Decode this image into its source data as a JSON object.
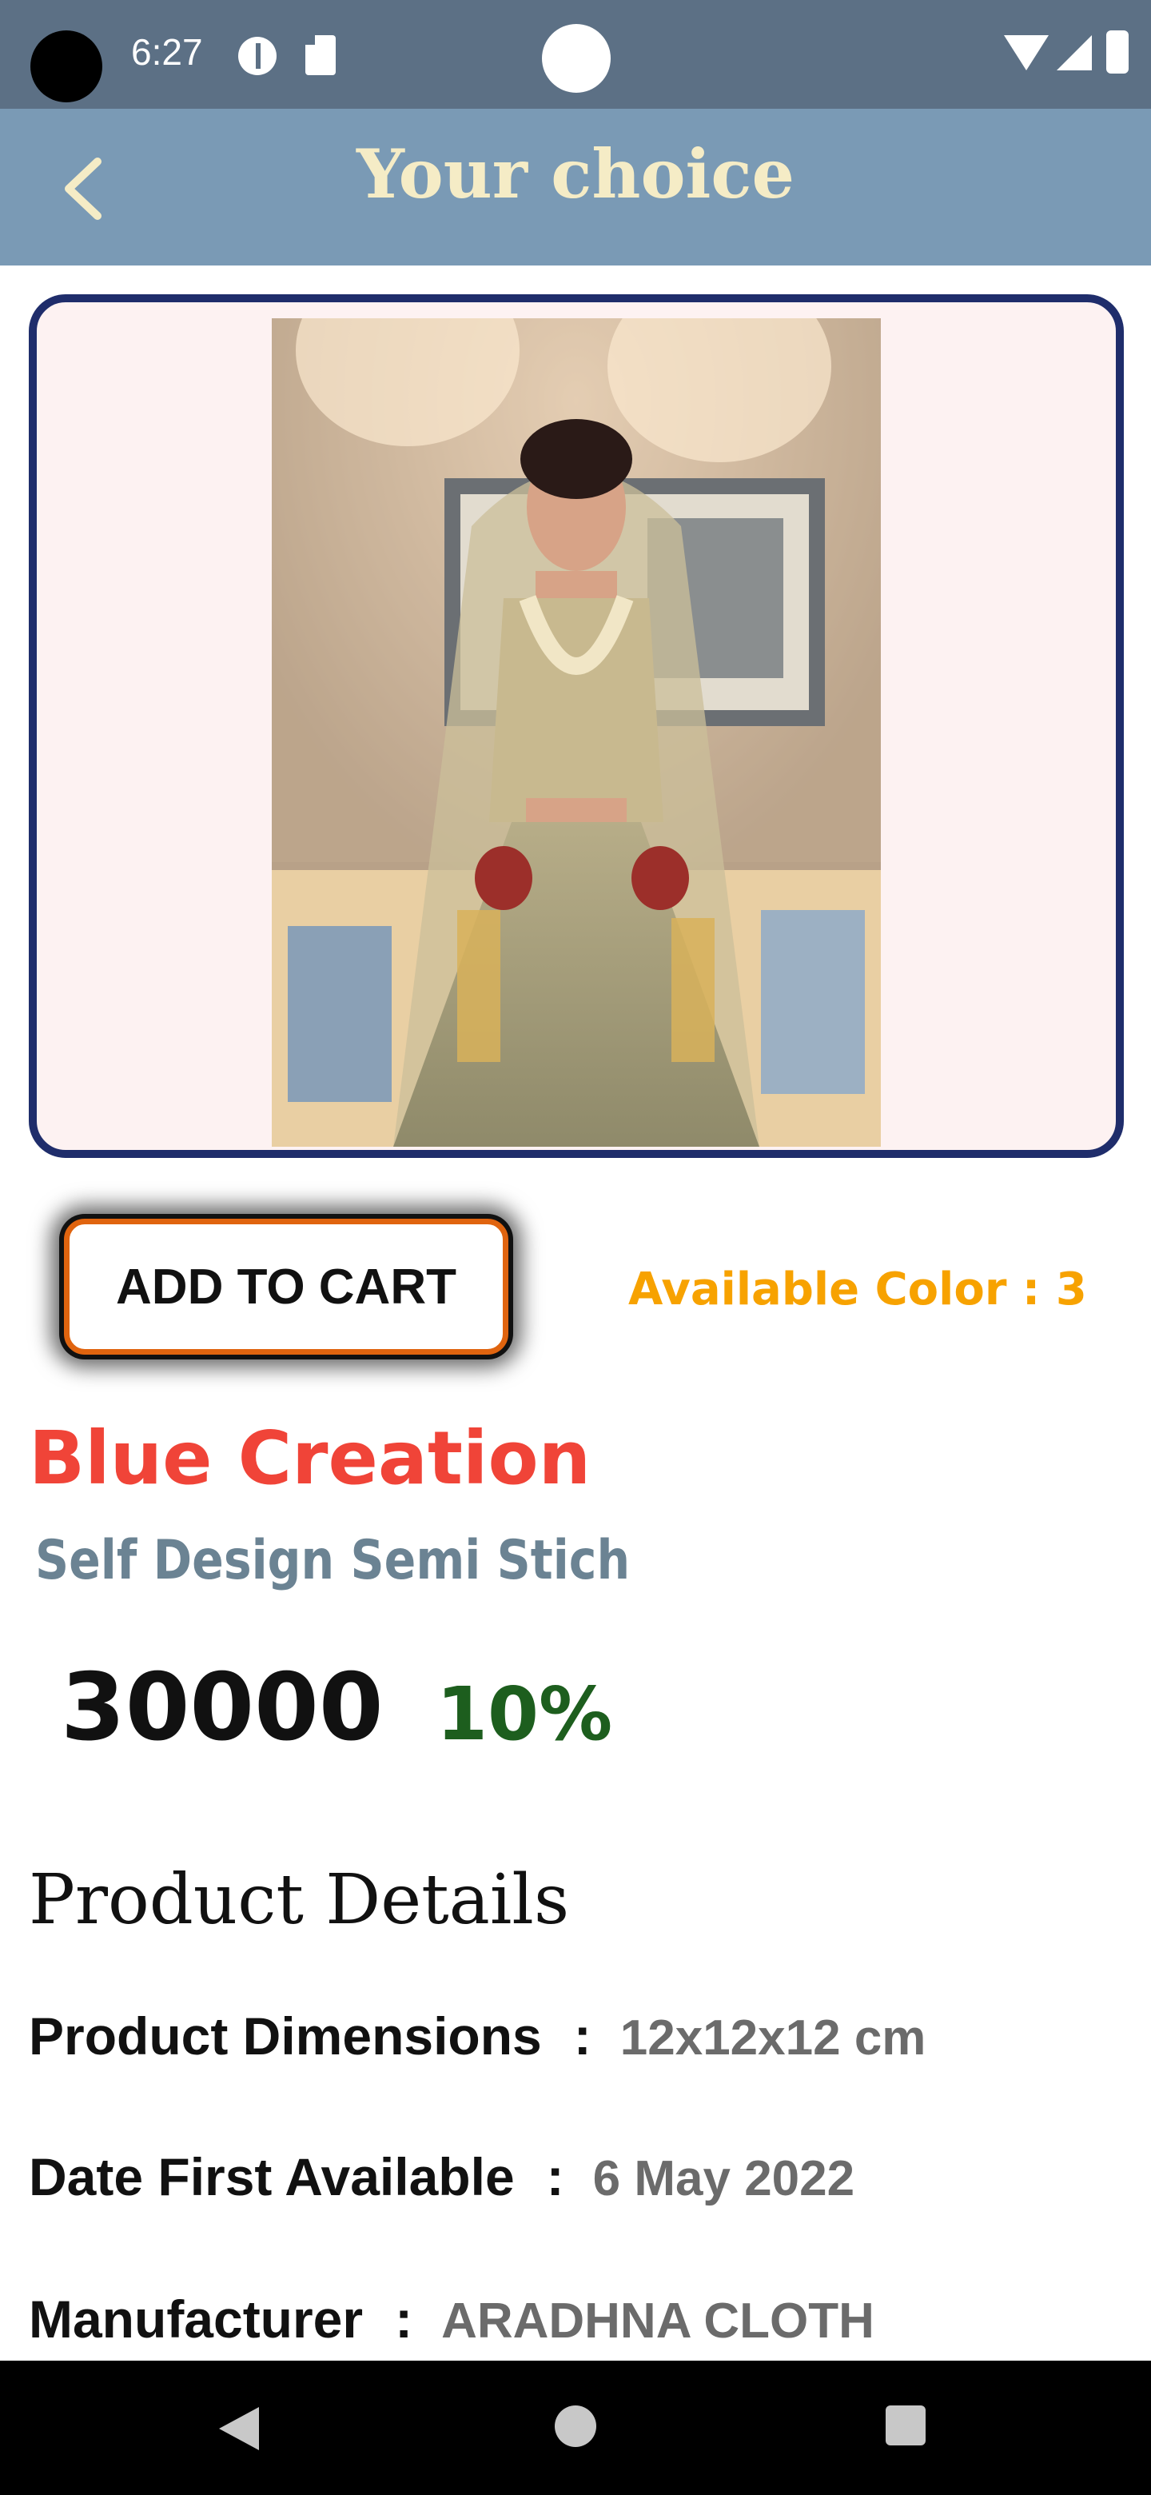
{
  "status_bar": {
    "time": "6:27"
  },
  "app_bar": {
    "title": "Your choice",
    "back_icon": "chevron-left-icon"
  },
  "product": {
    "image_alt": "Bride in embroidered lehenga",
    "add_to_cart_label": "ADD TO CART",
    "available_color_text": "Available Color : 3",
    "brand": "Blue Creation",
    "subtitle": "Self Design Semi Stich",
    "price": "30000",
    "discount": "10%"
  },
  "details": {
    "heading": "Product Details",
    "separator": ":",
    "rows": [
      {
        "label": "Product Dimensions",
        "value": "12x12x12 cm"
      },
      {
        "label": "Date First Available",
        "value": "6 May 2022"
      },
      {
        "label": "Manufacturer",
        "value": "ARADHNA CLOTH"
      }
    ]
  },
  "colors": {
    "status_bar": "#5c7085",
    "app_bar": "#7a9ab5",
    "title": "#f5ecc6",
    "card_border": "#1f2d6b",
    "card_bg": "#fdf2f2",
    "cart_border": "#e0640f",
    "available_color": "#f7a200",
    "brand": "#f04438",
    "subtitle": "#6b8393",
    "discount": "#1d5e1e",
    "detail_value": "#6b6b6b"
  },
  "navigation": {
    "back": "nav-back-icon",
    "home": "nav-home-icon",
    "recent": "nav-recent-icon"
  }
}
